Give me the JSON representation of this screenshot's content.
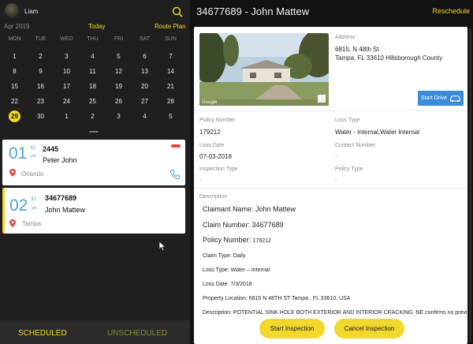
{
  "header": {
    "user_name": "Liam",
    "calendar_month": "Apr 2019",
    "today_label": "Today",
    "route_plan_label": "Route Plan"
  },
  "calendar": {
    "weekdays": [
      "MON",
      "TUE",
      "WED",
      "THU",
      "FRI",
      "SAT",
      "SUN"
    ],
    "weeks": [
      [
        "1",
        "2",
        "3",
        "4",
        "5",
        "6",
        "7"
      ],
      [
        "8",
        "9",
        "10",
        "11",
        "12",
        "13",
        "14"
      ],
      [
        "15",
        "16",
        "17",
        "18",
        "19",
        "20",
        "21"
      ],
      [
        "22",
        "23",
        "24",
        "25",
        "26",
        "27",
        "28"
      ],
      [
        "29",
        "30",
        "1",
        "2",
        "3",
        "4",
        "5"
      ]
    ],
    "selected_day": "29"
  },
  "appointments": [
    {
      "hour": "01",
      "minutes": "43",
      "ampm": "pm",
      "policy": "2445",
      "name": "Peter John",
      "city": "Orlando"
    },
    {
      "hour": "02",
      "minutes": "32",
      "ampm": "pm",
      "policy": "34677689",
      "name": "John Mattew",
      "city": "Tampa"
    }
  ],
  "bottom_tabs": {
    "scheduled": "SCHEDULED",
    "unscheduled": "UNSCHEDULED"
  },
  "detail": {
    "title": "34677689 - John Mattew",
    "reschedule_label": "Reschedule",
    "address_label": "Address",
    "address_line1": "6815, N 48th St",
    "address_line2": "Tampa, FL 33610 Hillsborough County",
    "start_drive_label": "Start Drive",
    "photo_watermark": "Google",
    "fields": {
      "policy_number_label": "Policy Number",
      "policy_number": "179212",
      "loss_type_label": "Loss Type",
      "loss_type": "Water - Internal,Water Internal",
      "loss_date_label": "Loss Date",
      "loss_date": "07-03-2018",
      "contact_number_label": "Contact Number",
      "contact_number": "-",
      "inspection_type_label": "Inspection Type",
      "inspection_type": "-",
      "policy_type_label": "Policy Type",
      "policy_type": "-"
    },
    "description_label": "Description",
    "description": {
      "claimant_name": "Claimant Name: John Mattew",
      "claim_number": "Claim Number: 34677689",
      "policy_number_prefix": "Policy Number: ",
      "policy_number_value": "179212",
      "claim_type": "Claim Type: Daily",
      "loss_type": "Loss Type: Water – Internal",
      "loss_date": "Loss Date: 7/3/2018",
      "property_location": "Property Location: 6815 N 48TH ST Tampa , FL 33610, USA",
      "description_partial": "Description: POTENTIAL SINK HOLE BOTH EXTERIOR AND INTERIOR CRACKING. NE confirms no previ"
    },
    "start_inspection_label": "Start Inspection",
    "cancel_inspection_label": "Cancel Inspection"
  },
  "colors": {
    "accent": "#f2d72c",
    "time_blue": "#4fa3d3",
    "drive_blue": "#3b8bd6",
    "pin_red": "#e04848"
  }
}
